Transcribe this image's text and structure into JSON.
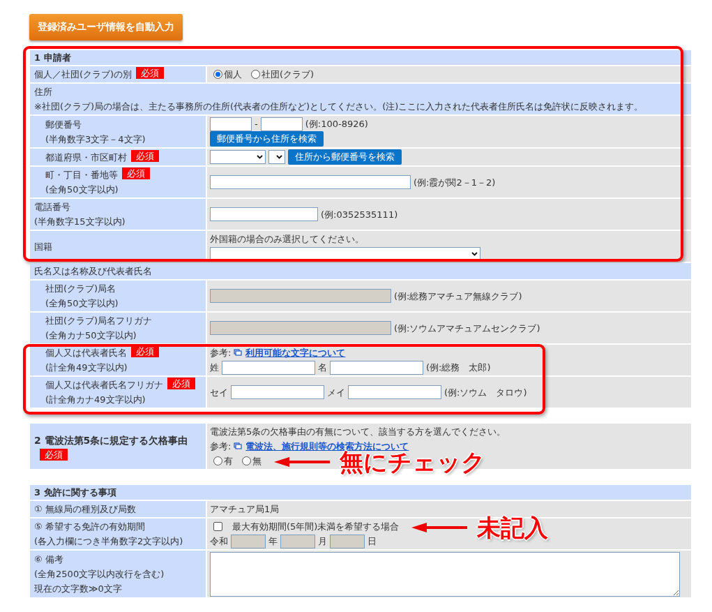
{
  "autofill_button": "登録済みユーザ情報を自動入力",
  "sections": [
    {
      "blocks": [
        {
          "highlighted": true,
          "header": "1 申請者",
          "rows": [
            {
              "kind": "row",
              "label": "個人／社団(クラブ)の別",
              "badge": "必須",
              "value": [
                {
                  "parts": [
                    {
                      "kind": "radio",
                      "label": "個人",
                      "selected": true
                    },
                    {
                      "kind": "radio",
                      "label": "社団(クラブ)",
                      "selected": false
                    }
                  ]
                }
              ]
            },
            {
              "kind": "group",
              "label": "住所",
              "note": "※社団(クラブ)局の場合は、主たる事務所の住所(代表者の住所など)としてください。(注)ここに入力された代表者住所氏名は免許状に反映されます。",
              "children": [
                {
                  "kind": "row",
                  "label": "郵便番号",
                  "sub": "(半角数字3文字－4文字)",
                  "value": [
                    {
                      "parts": [
                        {
                          "kind": "short-field"
                        },
                        {
                          "kind": "text",
                          "text": "-"
                        },
                        {
                          "kind": "short-field"
                        },
                        {
                          "kind": "text",
                          "text": "(例:100-8926)"
                        }
                      ]
                    },
                    {
                      "parts": [
                        {
                          "kind": "button",
                          "text": "郵便番号から住所を検索"
                        }
                      ]
                    }
                  ]
                },
                {
                  "kind": "row",
                  "label": "都道府県・市区町村",
                  "badge": "必須",
                  "value": [
                    {
                      "parts": [
                        {
                          "kind": "select"
                        },
                        {
                          "kind": "small-select"
                        },
                        {
                          "kind": "button",
                          "text": "住所から郵便番号を検索"
                        }
                      ]
                    }
                  ]
                },
                {
                  "kind": "row",
                  "label": "町・丁目・番地等",
                  "badge": "必須",
                  "sub": "(全角50文字以内)",
                  "value": [
                    {
                      "parts": [
                        {
                          "kind": "wide-field"
                        },
                        {
                          "kind": "text",
                          "text": "(例:霞が関2－1－2)"
                        }
                      ]
                    }
                  ]
                }
              ]
            },
            {
              "kind": "row",
              "label": "電話番号",
              "sub": "(半角数字15文字以内)",
              "value": [
                {
                  "parts": [
                    {
                      "kind": "field"
                    },
                    {
                      "kind": "text",
                      "text": "(例:0352535111)"
                    }
                  ]
                }
              ]
            },
            {
              "kind": "row",
              "label": "国籍",
              "value": [
                {
                  "parts": [
                    {
                      "kind": "text",
                      "text": "外国籍の場合のみ選択してください。"
                    }
                  ]
                },
                {
                  "parts": [
                    {
                      "kind": "wide-select"
                    }
                  ]
                }
              ]
            }
          ]
        },
        {
          "highlighted": false,
          "rows": [
            {
              "kind": "group",
              "label": "氏名又は名称及び代表者氏名",
              "blocks": [
                {
                  "highlighted": false,
                  "rows": [
                    {
                      "kind": "row",
                      "label": "社団(クラブ)局名",
                      "sub": "(全角50文字以内)",
                      "value": [
                        {
                          "parts": [
                            {
                              "kind": "club-field",
                              "disabled": true
                            },
                            {
                              "kind": "text",
                              "text": "(例:総務アマチュア無線クラブ)"
                            }
                          ]
                        }
                      ]
                    },
                    {
                      "kind": "row",
                      "label": "社団(クラブ)局名フリガナ",
                      "sub": "(全角カナ50文字以内)",
                      "value": [
                        {
                          "parts": [
                            {
                              "kind": "club-field",
                              "disabled": true
                            },
                            {
                              "kind": "text",
                              "text": "(例:ソウムアマチュアムセンクラブ)"
                            }
                          ]
                        }
                      ]
                    }
                  ]
                },
                {
                  "highlighted": true,
                  "rows": [
                    {
                      "kind": "row",
                      "label": "個人又は代表者氏名",
                      "badge": "必須",
                      "sub": "(計全角49文字以内)",
                      "value": [
                        {
                          "parts": [
                            {
                              "kind": "text",
                              "text": "参考:"
                            },
                            {
                              "kind": "link",
                              "text": "利用可能な文字について"
                            }
                          ]
                        },
                        {
                          "parts": [
                            {
                              "kind": "text",
                              "text": "姓"
                            },
                            {
                              "kind": "name-field"
                            },
                            {
                              "kind": "text",
                              "text": "名"
                            },
                            {
                              "kind": "name-field"
                            },
                            {
                              "kind": "text",
                              "text": "(例:総務　太郎)"
                            }
                          ]
                        }
                      ]
                    },
                    {
                      "kind": "row",
                      "label": "個人又は代表者氏名フリガナ",
                      "badge": "必須",
                      "sub": "(計全角カナ49文字以内)",
                      "value": [
                        {
                          "parts": [
                            {
                              "kind": "text",
                              "text": "セイ"
                            },
                            {
                              "kind": "name-field"
                            },
                            {
                              "kind": "text",
                              "text": "メイ"
                            },
                            {
                              "kind": "name-field"
                            },
                            {
                              "kind": "text",
                              "text": "(例:ソウム　タロウ)"
                            }
                          ]
                        }
                      ]
                    }
                  ]
                }
              ]
            }
          ]
        }
      ]
    },
    {
      "blocks": [
        {
          "highlighted": false,
          "rows": [
            {
              "kind": "title-row",
              "label": "2 電波法第5条に規定する欠格事由",
              "badge": "必須",
              "value": [
                {
                  "parts": [
                    {
                      "kind": "text",
                      "text": "電波法第5条の欠格事由の有無について、該当する方を選んでください。"
                    }
                  ]
                },
                {
                  "parts": [
                    {
                      "kind": "text",
                      "text": "参考:"
                    },
                    {
                      "kind": "link",
                      "text": "電波法、施行規則等の検索方法について"
                    }
                  ]
                },
                {
                  "parts": [
                    {
                      "kind": "radio",
                      "label": "有",
                      "selected": false
                    },
                    {
                      "kind": "radio",
                      "label": "無",
                      "selected": false
                    }
                  ],
                  "callout": "無にチェック"
                }
              ]
            }
          ]
        }
      ]
    },
    {
      "blocks": [
        {
          "highlighted": false,
          "header": "3 免許に関する事項",
          "rows": [
            {
              "kind": "row",
              "label": "① 無線局の種別及び局数",
              "value": [
                {
                  "parts": [
                    {
                      "kind": "text",
                      "text": "アマチュア局1局"
                    }
                  ]
                }
              ]
            },
            {
              "kind": "row",
              "label": "⑤ 希望する免許の有効期間",
              "sub": "(各入力欄につき半角数字2文字以内)",
              "value": [
                {
                  "parts": [
                    {
                      "kind": "checkbox",
                      "label": "最大有効期間(5年間)未満を希望する場合",
                      "checked": false
                    }
                  ],
                  "callout": "未記入"
                },
                {
                  "parts": [
                    {
                      "kind": "text",
                      "text": "令和"
                    },
                    {
                      "kind": "date-field",
                      "disabled": true
                    },
                    {
                      "kind": "text",
                      "text": "年"
                    },
                    {
                      "kind": "date-field",
                      "disabled": true
                    },
                    {
                      "kind": "text",
                      "text": "月"
                    },
                    {
                      "kind": "date-field",
                      "disabled": true
                    },
                    {
                      "kind": "text",
                      "text": "日"
                    }
                  ]
                }
              ]
            },
            {
              "kind": "row",
              "label": "⑥ 備考",
              "sub": "(全角2500文字以内改行を含む)",
              "sub2": "現在の文字数≫0文字",
              "value": [
                {
                  "parts": [
                    {
                      "kind": "textarea"
                    }
                  ]
                }
              ]
            }
          ]
        }
      ]
    }
  ]
}
